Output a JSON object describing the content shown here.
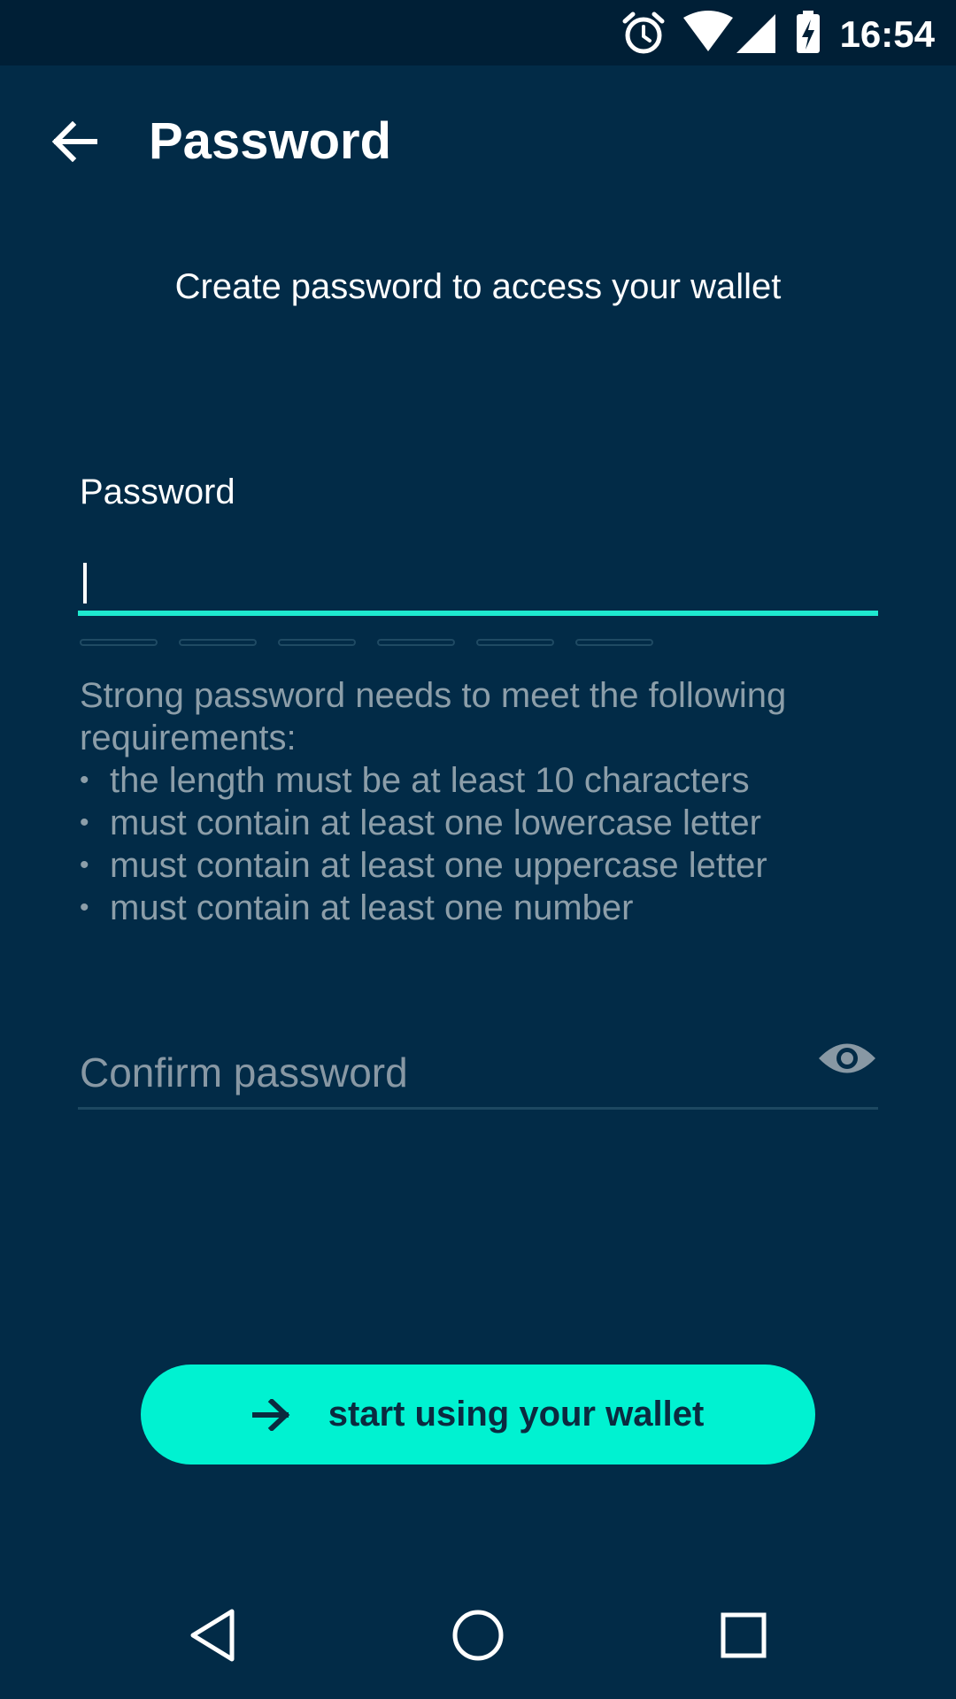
{
  "status_bar": {
    "time": "16:54",
    "icons": [
      "alarm-icon",
      "wifi-icon",
      "signal-icon",
      "battery-charging-icon"
    ]
  },
  "app_bar": {
    "back_icon": "arrow-back-icon",
    "title": "Password"
  },
  "subtitle": "Create password to access your wallet",
  "password_field": {
    "label": "Password",
    "value": "",
    "accent_color": "#1ee9cf",
    "strength_segments": 6,
    "strength_filled": 0
  },
  "requirements": {
    "intro": "Strong password needs to meet the following requirements:",
    "items": [
      "the length must be at least 10 characters",
      "must contain at least one lowercase letter",
      "must contain at least one uppercase letter",
      "must contain at least one number"
    ]
  },
  "confirm_field": {
    "placeholder": "Confirm password",
    "value": "",
    "toggle_icon": "eye-icon"
  },
  "cta": {
    "icon": "arrow-right-icon",
    "label": "start using your wallet",
    "background": "#00f2d1"
  },
  "nav_bar": {
    "icons": [
      "back-triangle-icon",
      "home-circle-icon",
      "recents-square-icon"
    ]
  },
  "colors": {
    "background": "#022b47",
    "status_bar": "#001f36",
    "muted_text": "#8c9ea9"
  }
}
